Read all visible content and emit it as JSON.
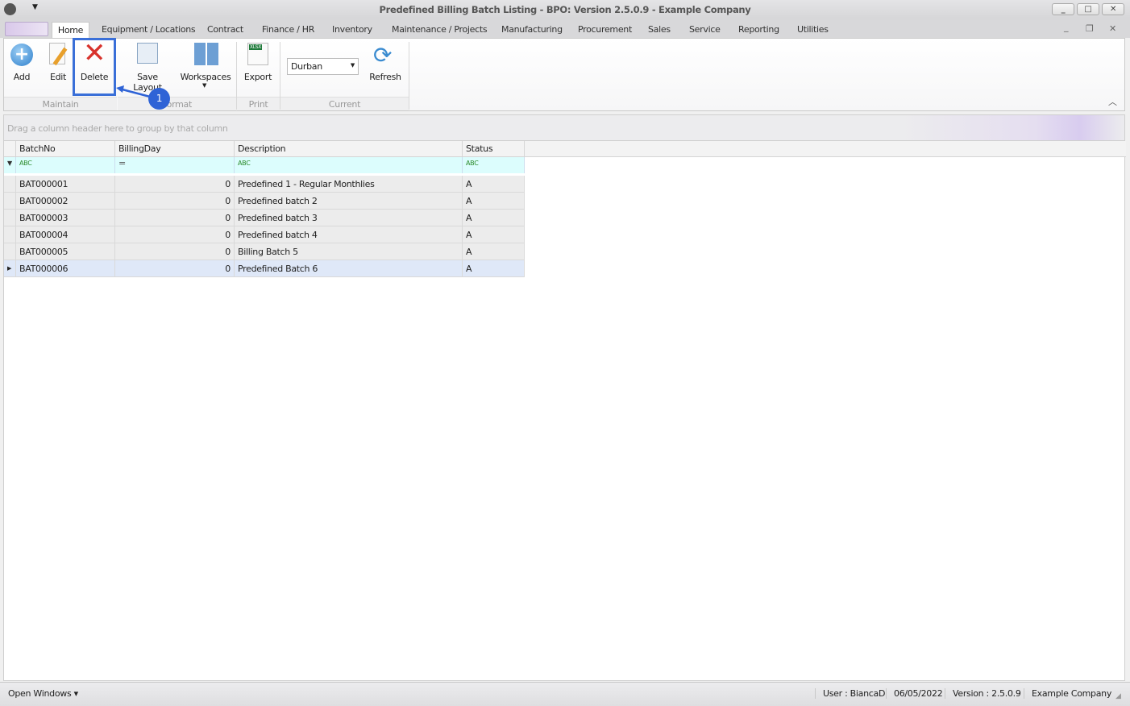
{
  "window": {
    "title": "Predefined Billing Batch Listing - BPO: Version 2.5.0.9 - Example Company",
    "minimize": "_",
    "maximize": "□",
    "close": "✕"
  },
  "menu_tabs": [
    "Home",
    "Equipment / Locations",
    "Contract",
    "Finance / HR",
    "Inventory",
    "Maintenance / Projects",
    "Manufacturing",
    "Procurement",
    "Sales",
    "Service",
    "Reporting",
    "Utilities"
  ],
  "ribbon": {
    "buttons": {
      "add": "Add",
      "edit": "Edit",
      "delete": "Delete",
      "save_layout": "Save Layout",
      "workspaces": "Workspaces",
      "export": "Export",
      "refresh": "Refresh"
    },
    "groups": {
      "maintain": "Maintain",
      "format": "Format",
      "print": "Print",
      "current": "Current"
    },
    "branch_select": "Durban",
    "annotation": "1"
  },
  "grid": {
    "group_hint": "Drag a column header here to group by that column",
    "columns": [
      "BatchNo",
      "BillingDay",
      "Description",
      "Status"
    ],
    "rows": [
      [
        "BAT000001",
        "0",
        "Predefined 1 - Regular Monthlies",
        "A"
      ],
      [
        "BAT000002",
        "0",
        "Predefined batch 2",
        "A"
      ],
      [
        "BAT000003",
        "0",
        "Predefined batch 3",
        "A"
      ],
      [
        "BAT000004",
        "0",
        "Predefined batch 4",
        "A"
      ],
      [
        "BAT000005",
        "0",
        "Billing Batch 5",
        "A"
      ],
      [
        "BAT000006",
        "0",
        "Predefined Batch 6",
        "A"
      ]
    ],
    "selected_row": 5
  },
  "statusbar": {
    "open_windows": "Open Windows ▾",
    "user": "User : BiancaD",
    "date": "06/05/2022",
    "version": "Version : 2.5.0.9",
    "company": "Example Company"
  },
  "colors": {
    "accent": "#3a6fd8",
    "selected_row": "#dfe8f8",
    "filter_row": "#dcfdfd"
  }
}
